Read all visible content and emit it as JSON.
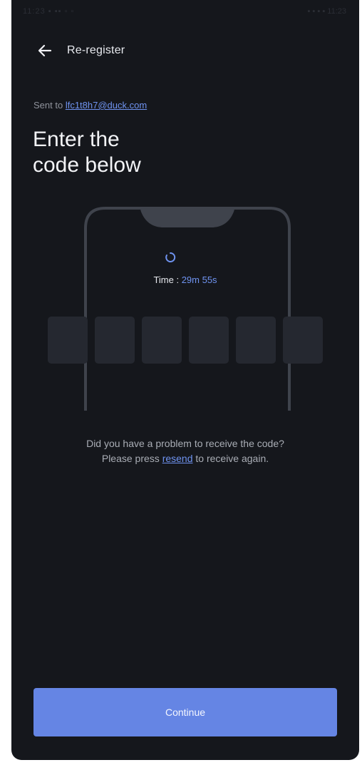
{
  "status_bar": {
    "left": "11:23 ▪ ▪▪ ▫ ▫",
    "right": "▪ ▪ ▪ ▪ 11:23"
  },
  "header": {
    "back_icon": "arrow-left-icon",
    "title": "Re-register"
  },
  "sent": {
    "prefix": "Sent to ",
    "email": "lfc1t8h7@duck.com"
  },
  "title": {
    "line1": "Enter the",
    "line2": "code below"
  },
  "timer": {
    "label": "Time : ",
    "value": "29m 55s"
  },
  "code_inputs": [
    "",
    "",
    "",
    "",
    "",
    ""
  ],
  "help": {
    "line1": "Did you have a problem to receive the code?",
    "line2_prefix": "Please press ",
    "resend": "resend",
    "line2_suffix": " to receive again."
  },
  "continue_label": "Continue",
  "colors": {
    "background": "#15171c",
    "accent": "#6585e4",
    "link": "#6f93f0",
    "input_box": "#252830"
  }
}
